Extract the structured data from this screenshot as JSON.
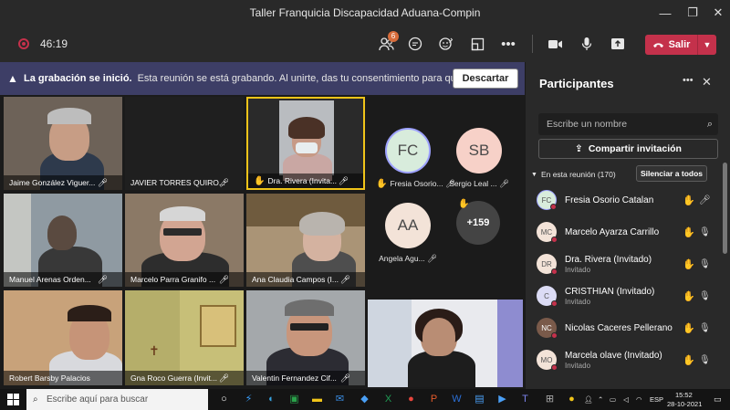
{
  "window": {
    "title": "Taller Franquicia Discapacidad Aduana-Compin"
  },
  "toolbar": {
    "timer": "46:19",
    "participants_badge": "6",
    "leave_label": "Salir"
  },
  "banner": {
    "title": "La grabación se inició.",
    "message": "Esta reunión se está grabando. Al unirte, das tu consentimiento para que se gra...",
    "dismiss_label": "Descartar"
  },
  "tiles": [
    {
      "name": "Jaime González Viguer..."
    },
    {
      "name": "JAVIER TORRES QUIRO..."
    },
    {
      "name": "Dra. Rivera (Invita..."
    },
    {
      "name": "Manuel Arenas Orden..."
    },
    {
      "name": "Marcelo Parra Granifo ..."
    },
    {
      "name": "Ana Claudia Campos (I..."
    },
    {
      "name": "Robert Barsby Palacios"
    },
    {
      "name": "Gna Roco Guerra (Invit..."
    },
    {
      "name": "Valentin Fernandez Cif..."
    }
  ],
  "avatars": [
    {
      "initials": "FC",
      "name": "Fresia Osorio...",
      "color": "#d8ecdc"
    },
    {
      "initials": "SB",
      "name": "Sergio Leal ...",
      "color": "#f7d1c8"
    },
    {
      "initials": "AA",
      "name": "Angela Agu...",
      "color": "#f3e3d8"
    }
  ],
  "more_count": "+159",
  "panel": {
    "title": "Participantes",
    "search_placeholder": "Escribe un nombre",
    "share_label": "Compartir invitación",
    "section_label": "En esta reunión (170)",
    "mute_all_label": "Silenciar a todos",
    "participants": [
      {
        "initials": "FC",
        "name": "Fresia Osorio Catalan",
        "sub": "",
        "color": "#d8ecdc"
      },
      {
        "initials": "MC",
        "name": "Marcelo Ayarza Carrillo",
        "sub": "",
        "color": "#f3e3d8"
      },
      {
        "initials": "DR",
        "name": "Dra. Rivera (Invitado)",
        "sub": "Invitado",
        "color": "#f3e3d8"
      },
      {
        "initials": "C",
        "name": "CRISTHIAN (Invitado)",
        "sub": "Invitado",
        "color": "#dcdcf5"
      },
      {
        "initials": "NC",
        "name": "Nicolas Caceres Pellerano",
        "sub": "",
        "color": "#7a5a4a"
      },
      {
        "initials": "MO",
        "name": "Marcela olave (Invitado)",
        "sub": "Invitado",
        "color": "#f3e3d8"
      }
    ]
  },
  "taskbar": {
    "search_placeholder": "Escribe aquí para buscar",
    "language": "ESP",
    "time": "15:52",
    "date": "28-10-2021"
  }
}
